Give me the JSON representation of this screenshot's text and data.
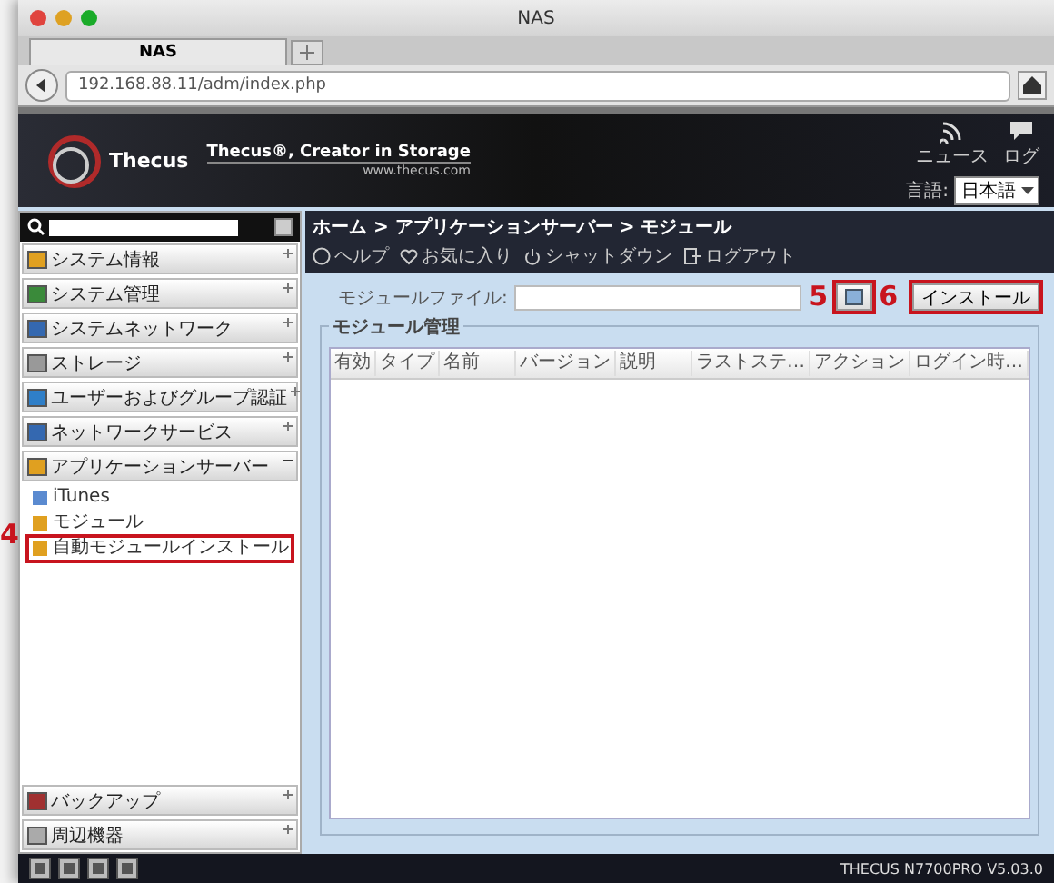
{
  "window": {
    "title": "NAS"
  },
  "tabs": [
    {
      "label": "NAS",
      "selected": true
    }
  ],
  "address_bar": {
    "url": "192.168.88.11/adm/index.php"
  },
  "header": {
    "logo": "Thecus",
    "tagline": "Thecus®, Creator in Storage",
    "website": "www.thecus.com",
    "links": [
      {
        "label": "ニュース",
        "kind": "feed"
      },
      {
        "label": "ログ",
        "kind": "log"
      }
    ],
    "language_label": "言語:",
    "language_value": "日本語"
  },
  "sidebar": {
    "items": [
      {
        "label": "システム情報",
        "expanded": false
      },
      {
        "label": "システム管理",
        "expanded": false
      },
      {
        "label": "システムネットワーク",
        "expanded": false
      },
      {
        "label": "ストレージ",
        "expanded": false
      },
      {
        "label": "ユーザーおよびグループ認証",
        "expanded": false
      },
      {
        "label": "ネットワークサービス",
        "expanded": false
      },
      {
        "label": "アプリケーションサーバー",
        "expanded": true,
        "children": [
          {
            "label": "iTunes",
            "highlighted": false
          },
          {
            "label": "モジュール",
            "highlighted": false
          },
          {
            "label": "自動モジュールインストール",
            "highlighted": true,
            "callout": "4"
          }
        ]
      }
    ],
    "bottom_items": [
      {
        "label": "バックアップ",
        "expanded": false
      },
      {
        "label": "周辺機器",
        "expanded": false
      }
    ]
  },
  "breadcrumb": "ホーム > アプリケーションサーバー > モジュール",
  "top_links": [
    {
      "label": "ヘルプ",
      "kind": "help"
    },
    {
      "label": "お気に入り",
      "kind": "favorite"
    },
    {
      "label": "シャットダウン",
      "kind": "power"
    },
    {
      "label": "ログアウト",
      "kind": "logout"
    }
  ],
  "module_file": {
    "label": "モジュールファイル:",
    "browse": {
      "highlighted": true,
      "callout": "5"
    },
    "install": {
      "label": "インストール",
      "highlighted": true,
      "callout": "6"
    }
  },
  "module_management": {
    "title": "モジュール管理",
    "columns": [
      "有効",
      "タイプ",
      "名前",
      "バージョン",
      "説明",
      "ラストステ…",
      "アクション",
      "ログイン時…"
    ]
  },
  "status_bar": {
    "model": "THECUS N7700PRO V5.03.0"
  }
}
